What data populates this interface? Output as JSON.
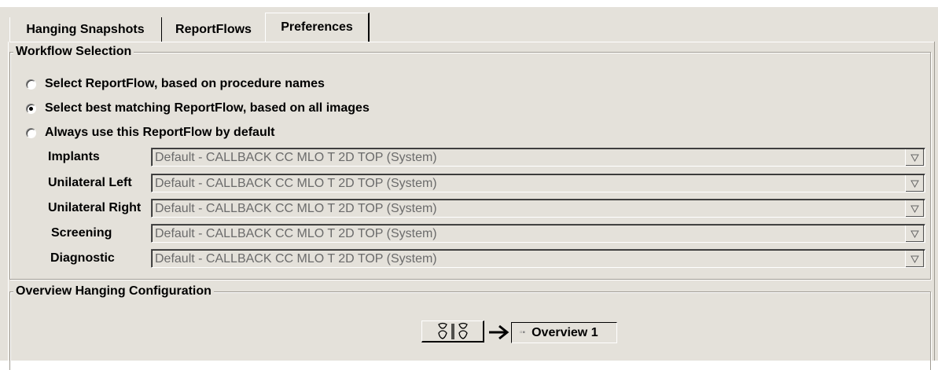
{
  "tabs": [
    {
      "label": "Hanging Snapshots",
      "active": false
    },
    {
      "label": "ReportFlows",
      "active": false
    },
    {
      "label": "Preferences",
      "active": true
    }
  ],
  "workflow_selection": {
    "title": "Workflow Selection",
    "options": [
      {
        "label": "Select ReportFlow, based on procedure names",
        "checked": false
      },
      {
        "label": "Select best matching ReportFlow, based on all images",
        "checked": true
      },
      {
        "label": "Always use this ReportFlow by default",
        "checked": false
      }
    ],
    "combos": [
      {
        "label": "Implants",
        "value": "Default - CALLBACK CC MLO T 2D TOP (System)"
      },
      {
        "label": "Unilateral Left",
        "value": "Default - CALLBACK CC MLO T 2D TOP (System)"
      },
      {
        "label": "Unilateral Right",
        "value": "Default - CALLBACK CC MLO T 2D TOP (System)"
      },
      {
        "label": "Screening",
        "value": "Default - CALLBACK CC MLO T 2D TOP (System)"
      },
      {
        "label": "Diagnostic",
        "value": "Default - CALLBACK CC MLO T 2D TOP (System)"
      }
    ]
  },
  "overview_hanging": {
    "title": "Overview Hanging Configuration",
    "selected_overview": "Overview 1",
    "icons": {
      "layout": "breast-layout-icon",
      "arrow": "arrow-right-icon",
      "small": "overview-thumbnail-icon"
    }
  },
  "colors": {
    "background": "#e4e1da",
    "disabled_text": "#6b6b6b"
  }
}
